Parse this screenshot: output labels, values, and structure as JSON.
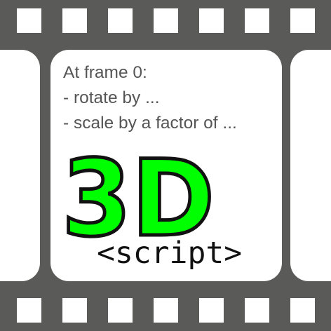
{
  "logo": {
    "title": "3D",
    "subtitle": "<script>",
    "title_color": "#00ff00",
    "outline_color": "#111111",
    "film_color": "#5a5a58"
  },
  "description_lines": [
    "At frame 0:",
    "- rotate by ...",
    "- scale by a factor of ..."
  ]
}
